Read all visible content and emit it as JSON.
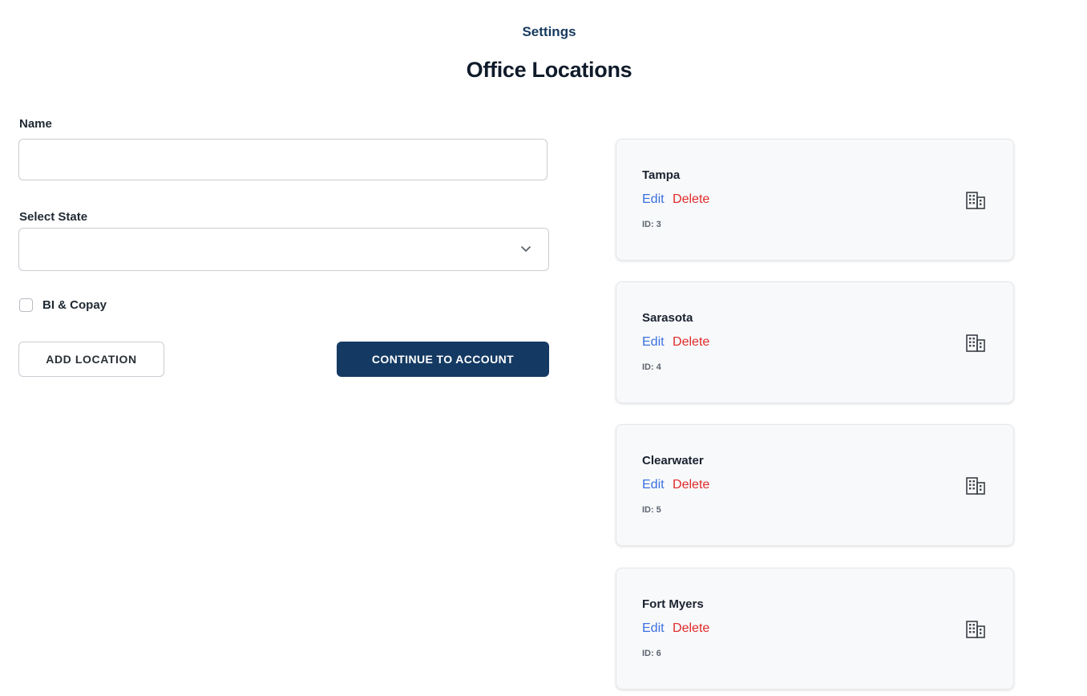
{
  "header": {
    "section_label": "Settings",
    "title": "Office Locations"
  },
  "form": {
    "name_label": "Name",
    "name_value": "",
    "name_placeholder": "",
    "state_label": "Select State",
    "state_value": "",
    "checkbox_label": "BI & Copay",
    "checkbox_checked": false,
    "add_button_label": "ADD LOCATION",
    "continue_button_label": "CONTINUE TO ACCOUNT"
  },
  "locations": [
    {
      "name": "Tampa",
      "edit_label": "Edit",
      "delete_label": "Delete",
      "id_label": "ID:",
      "id": "3",
      "icon": "building-icon"
    },
    {
      "name": "Sarasota",
      "edit_label": "Edit",
      "delete_label": "Delete",
      "id_label": "ID:",
      "id": "4",
      "icon": "building-icon"
    },
    {
      "name": "Clearwater",
      "edit_label": "Edit",
      "delete_label": "Delete",
      "id_label": "ID:",
      "id": "5",
      "icon": "building-icon"
    },
    {
      "name": "Fort Myers",
      "edit_label": "Edit",
      "delete_label": "Delete",
      "id_label": "ID:",
      "id": "6",
      "icon": "building-icon"
    }
  ],
  "colors": {
    "primary": "#143a63",
    "link": "#3b6fe0",
    "danger": "#e02a2a"
  }
}
